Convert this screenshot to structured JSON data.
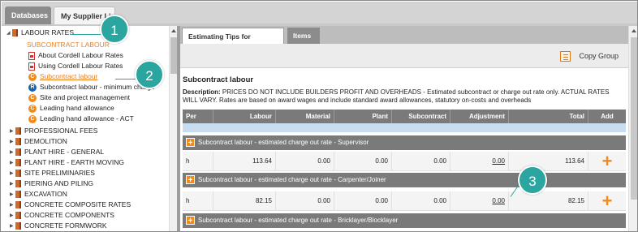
{
  "top_tabs": [
    "Databases",
    "My Supplier List"
  ],
  "tree": {
    "labour_rates": "LABOUR RATES",
    "section_label": "SUBCONTRACT LABOUR",
    "children": [
      {
        "label": "About Cordell Labour Rates",
        "icon": "pdf-icon"
      },
      {
        "label": "Using Cordell Labour Rates",
        "icon": "pdf-icon"
      },
      {
        "label": "Subcontract labour",
        "icon": "c-circle-icon",
        "active": true
      },
      {
        "label": "Subcontract labour - minimum charge",
        "icon": "r-circle-icon"
      },
      {
        "label": "Site and project management",
        "icon": "c-circle-icon"
      },
      {
        "label": "Leading hand allowance",
        "icon": "c-circle-icon"
      },
      {
        "label": "Leading hand allowance - ACT",
        "icon": "c-circle-icon"
      }
    ],
    "categories": [
      "PROFESSIONAL FEES",
      "DEMOLITION",
      "PLANT HIRE - GENERAL",
      "PLANT HIRE - EARTH MOVING",
      "SITE PRELIMINARIES",
      "PIERING AND PILING",
      "EXCAVATION",
      "CONCRETE COMPOSITE RATES",
      "CONCRETE COMPONENTS",
      "CONCRETE FORMWORK"
    ]
  },
  "subtabs": {
    "tips": "Estimating Tips for Category",
    "items": "Items"
  },
  "toolbar": {
    "copy_group": "Copy Group"
  },
  "content": {
    "heading": "Subcontract labour",
    "description_label": "Description:",
    "description_text": "PRICES DO NOT INCLUDE BUILDERS PROFIT AND OVERHEADS - Estimated subcontract or charge out rate only. ACTUAL RATES WILL VARY. Rates are based on award wages and include standard award allowances, statutory on-costs and overheads"
  },
  "table": {
    "headers": [
      "Per",
      "Labour",
      "Material",
      "Plant",
      "Subcontract",
      "Adjustment",
      "Total",
      "Add"
    ],
    "groups": [
      {
        "title": "Subcontract labour - estimated charge out rate - Supervisor",
        "row": {
          "per": "h",
          "labour": "113.64",
          "material": "0.00",
          "plant": "0.00",
          "subcontract": "0.00",
          "adjustment": "0.00",
          "total": "113.64",
          "add": "+"
        }
      },
      {
        "title": "Subcontract labour - estimated charge out rate - Carpenter/Joiner",
        "row": {
          "per": "h",
          "labour": "82.15",
          "material": "0.00",
          "plant": "0.00",
          "subcontract": "0.00",
          "adjustment": "0.00",
          "total": "82.15",
          "add": "+"
        }
      },
      {
        "title": "Subcontract labour - estimated charge out rate - Bricklayer/Blocklayer"
      }
    ],
    "group_plus": "+"
  },
  "callouts": [
    "1",
    "2",
    "3"
  ],
  "colors": {
    "accent": "#f08b1c",
    "callout": "#2aa5a0",
    "header_gray": "#7a7a7a"
  }
}
